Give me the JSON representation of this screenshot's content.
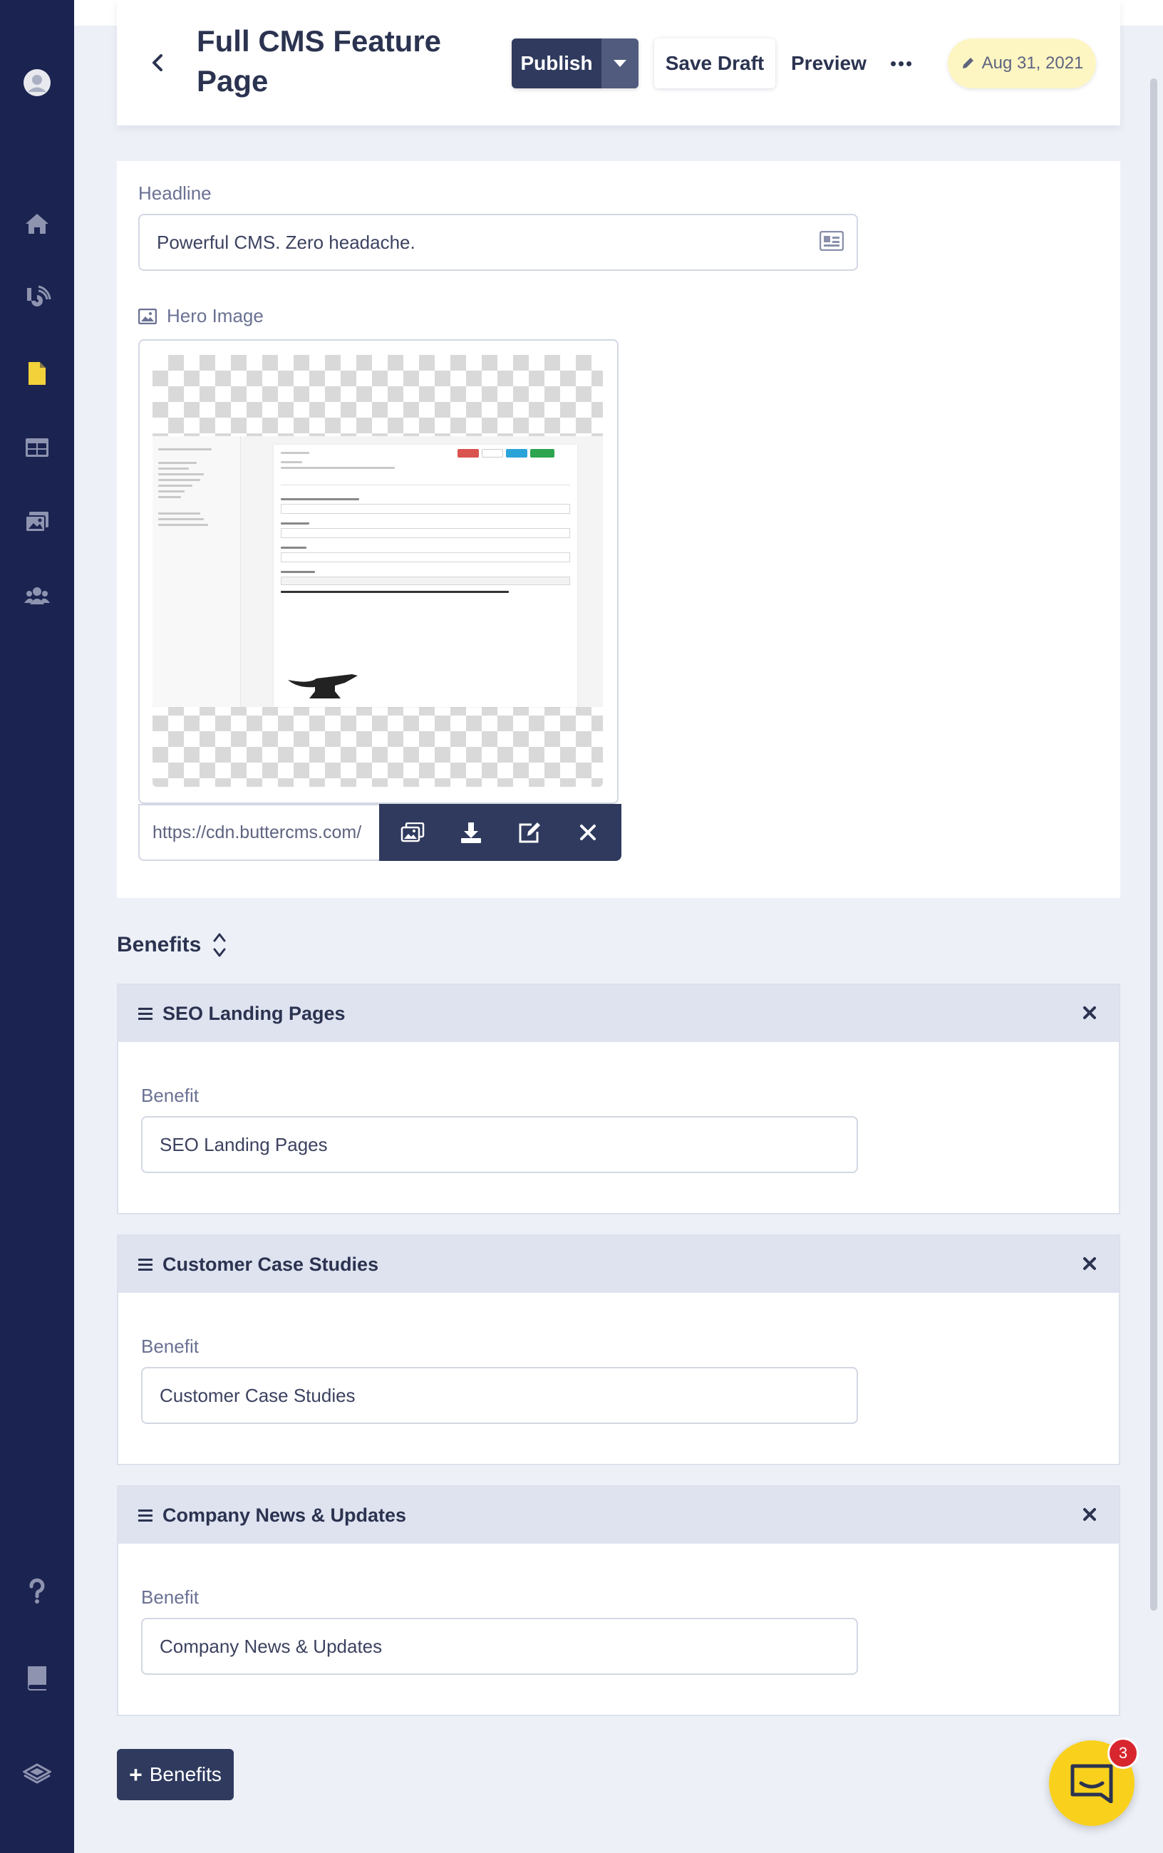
{
  "header": {
    "title": "Full CMS Feature Page",
    "publish_label": "Publish",
    "save_draft_label": "Save Draft",
    "preview_label": "Preview",
    "date": "Aug 31, 2021"
  },
  "fields": {
    "headline_label": "Headline",
    "headline_value": "Powerful CMS. Zero headache.",
    "hero_label": "Hero Image",
    "hero_url": "https://cdn.buttercms.com/"
  },
  "benefits": {
    "heading": "Benefits",
    "field_label": "Benefit",
    "items": [
      {
        "title": "SEO Landing Pages",
        "value": "SEO Landing Pages"
      },
      {
        "title": "Customer Case Studies",
        "value": "Customer Case Studies"
      },
      {
        "title": "Company News & Updates",
        "value": "Company News & Updates"
      }
    ],
    "add_label": "Benefits"
  },
  "chat": {
    "badge_count": "3"
  },
  "colors": {
    "sidebar": "#1b2350",
    "primary_button": "#2f3a5e",
    "active_nav": "#f2d13a",
    "date_badge": "#fdf6c3",
    "chat": "#f9d11c",
    "badge": "#d8262f"
  },
  "icons": {
    "sidebar": [
      "avatar-icon",
      "home-icon",
      "blog-icon",
      "pages-icon",
      "collections-icon",
      "media-icon",
      "users-icon",
      "help-icon",
      "docs-icon",
      "logo-icon"
    ],
    "hero_tools": [
      "replace-image-icon",
      "download-icon",
      "edit-icon",
      "close-icon"
    ]
  }
}
